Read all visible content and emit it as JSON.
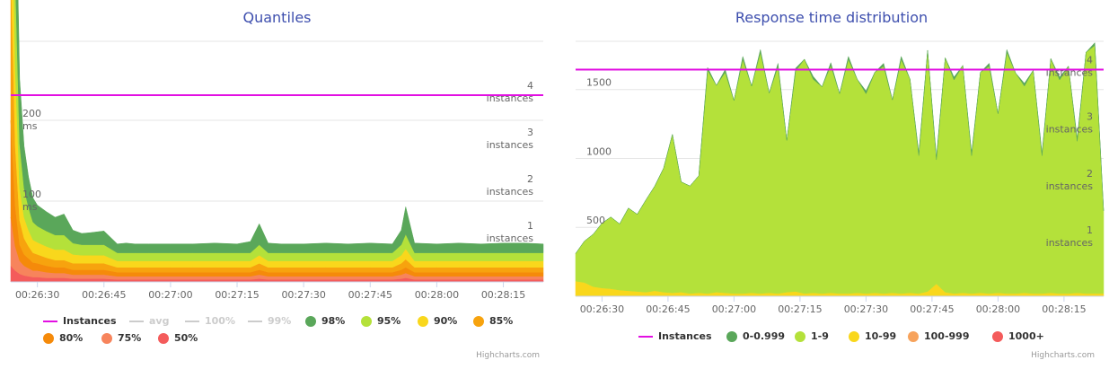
{
  "chart_data": [
    {
      "type": "area",
      "title": "Quantiles",
      "x": [
        "00:26:24",
        "00:26:25",
        "00:26:26",
        "00:26:27",
        "00:26:28",
        "00:26:29",
        "00:26:30",
        "00:26:32",
        "00:26:34",
        "00:26:36",
        "00:26:38",
        "00:26:40",
        "00:26:42",
        "00:26:45",
        "00:26:48",
        "00:26:50",
        "00:26:52",
        "00:26:55",
        "00:27:00",
        "00:27:05",
        "00:27:10",
        "00:27:15",
        "00:27:18",
        "00:27:20",
        "00:27:22",
        "00:27:25",
        "00:27:30",
        "00:27:35",
        "00:27:40",
        "00:27:45",
        "00:27:50",
        "00:27:52",
        "00:27:53",
        "00:27:55",
        "00:28:00",
        "00:28:05",
        "00:28:10",
        "00:28:15",
        "00:28:20",
        "00:28:24"
      ],
      "x_ticks": [
        "00:26:30",
        "00:26:45",
        "00:27:00",
        "00:27:15",
        "00:27:30",
        "00:27:45",
        "00:28:00",
        "00:28:15"
      ],
      "y_ticks": [
        {
          "value": 100,
          "label_num": "100",
          "label_unit": "ms"
        },
        {
          "value": 200,
          "label_num": "200",
          "label_unit": "ms"
        }
      ],
      "ylim": [
        0,
        260
      ],
      "y2_ticks": [
        {
          "value": 1,
          "label_num": "1",
          "label_unit": "instances"
        },
        {
          "value": 2,
          "label_num": "2",
          "label_unit": "instances"
        },
        {
          "value": 3,
          "label_num": "3",
          "label_unit": "instances"
        },
        {
          "value": 4,
          "label_num": "4",
          "label_unit": "instances"
        }
      ],
      "y2lim": [
        0,
        4.5
      ],
      "instances_value": 4,
      "series": [
        {
          "name": "50%",
          "color": "#f45b5b",
          "values": [
            20,
            14,
            10,
            8,
            7,
            6,
            6,
            5,
            5,
            5,
            4,
            4,
            4,
            4,
            3,
            3,
            3,
            3,
            3,
            3,
            3,
            3,
            3,
            4,
            3,
            3,
            3,
            3,
            3,
            3,
            3,
            4,
            5,
            3,
            3,
            3,
            3,
            3,
            3,
            3
          ]
        },
        {
          "name": "75%",
          "color": "#f7845c",
          "values": [
            60,
            30,
            16,
            12,
            10,
            8,
            8,
            7,
            6,
            6,
            5,
            5,
            5,
            5,
            4,
            4,
            4,
            4,
            4,
            4,
            4,
            4,
            4,
            5,
            4,
            4,
            4,
            4,
            4,
            4,
            4,
            5,
            6,
            4,
            4,
            4,
            4,
            4,
            4,
            4
          ]
        },
        {
          "name": "80%",
          "color": "#f58a0a",
          "values": [
            120,
            50,
            20,
            14,
            12,
            10,
            9,
            8,
            7,
            7,
            6,
            6,
            6,
            6,
            5,
            5,
            5,
            5,
            5,
            5,
            5,
            5,
            5,
            6,
            5,
            5,
            5,
            5,
            5,
            5,
            5,
            6,
            7,
            5,
            5,
            5,
            5,
            5,
            5,
            5
          ]
        },
        {
          "name": "85%",
          "color": "#f7a30e",
          "values": [
            190,
            75,
            30,
            20,
            15,
            12,
            11,
            10,
            9,
            9,
            8,
            8,
            8,
            8,
            6,
            6,
            6,
            6,
            6,
            6,
            6,
            6,
            6,
            8,
            6,
            6,
            6,
            6,
            6,
            6,
            6,
            8,
            10,
            6,
            6,
            6,
            6,
            6,
            6,
            6
          ]
        },
        {
          "name": "90%",
          "color": "#f9d71c",
          "values": [
            220,
            95,
            40,
            26,
            20,
            16,
            15,
            14,
            13,
            13,
            11,
            10,
            10,
            10,
            8,
            8,
            8,
            8,
            8,
            8,
            8,
            8,
            8,
            10,
            8,
            8,
            8,
            8,
            8,
            8,
            8,
            10,
            13,
            8,
            8,
            8,
            8,
            8,
            8,
            8
          ]
        },
        {
          "name": "95%",
          "color": "#b4e13a",
          "values": [
            240,
            120,
            55,
            36,
            28,
            22,
            20,
            19,
            18,
            18,
            14,
            13,
            13,
            13,
            10,
            10,
            10,
            10,
            10,
            10,
            10,
            10,
            10,
            13,
            10,
            10,
            10,
            10,
            10,
            10,
            10,
            13,
            18,
            10,
            10,
            10,
            10,
            10,
            10,
            10
          ]
        },
        {
          "name": "98%",
          "color": "#5aa75a",
          "values": [
            258,
            160,
            80,
            52,
            38,
            30,
            26,
            24,
            22,
            26,
            16,
            14,
            15,
            17,
            11,
            12,
            11,
            11,
            11,
            11,
            12,
            11,
            14,
            26,
            12,
            11,
            11,
            12,
            11,
            12,
            11,
            18,
            34,
            12,
            11,
            12,
            11,
            12,
            12,
            11
          ]
        }
      ],
      "legend": [
        {
          "name": "Instances",
          "kind": "line",
          "color": "#e20fe2",
          "visible": true
        },
        {
          "name": "avg",
          "kind": "line",
          "color": "#cccccc",
          "visible": false
        },
        {
          "name": "100%",
          "kind": "line",
          "color": "#cccccc",
          "visible": false
        },
        {
          "name": "99%",
          "kind": "line",
          "color": "#cccccc",
          "visible": false
        },
        {
          "name": "98%",
          "kind": "dot",
          "color": "#5aa75a",
          "visible": true
        },
        {
          "name": "95%",
          "kind": "dot",
          "color": "#b4e13a",
          "visible": true
        },
        {
          "name": "90%",
          "kind": "dot",
          "color": "#f9d71c",
          "visible": true
        },
        {
          "name": "85%",
          "kind": "dot",
          "color": "#f7a30e",
          "visible": true
        },
        {
          "name": "80%",
          "kind": "dot",
          "color": "#f58a0a",
          "visible": true
        },
        {
          "name": "75%",
          "kind": "dot",
          "color": "#f7845c",
          "visible": true
        },
        {
          "name": "50%",
          "kind": "dot",
          "color": "#f45b5b",
          "visible": true
        }
      ],
      "credits": "Highcharts.com"
    },
    {
      "type": "area",
      "title": "Response time distribution",
      "x": [
        "00:26:24",
        "00:26:26",
        "00:26:28",
        "00:26:30",
        "00:26:32",
        "00:26:34",
        "00:26:36",
        "00:26:38",
        "00:26:40",
        "00:26:42",
        "00:26:44",
        "00:26:46",
        "00:26:48",
        "00:26:50",
        "00:26:52",
        "00:26:54",
        "00:26:56",
        "00:26:58",
        "00:27:00",
        "00:27:02",
        "00:27:04",
        "00:27:06",
        "00:27:08",
        "00:27:10",
        "00:27:12",
        "00:27:14",
        "00:27:16",
        "00:27:18",
        "00:27:20",
        "00:27:22",
        "00:27:24",
        "00:27:26",
        "00:27:28",
        "00:27:30",
        "00:27:32",
        "00:27:34",
        "00:27:36",
        "00:27:38",
        "00:27:40",
        "00:27:42",
        "00:27:44",
        "00:27:46",
        "00:27:48",
        "00:27:50",
        "00:27:52",
        "00:27:54",
        "00:27:56",
        "00:27:58",
        "00:28:00",
        "00:28:02",
        "00:28:04",
        "00:28:06",
        "00:28:08",
        "00:28:10",
        "00:28:12",
        "00:28:14",
        "00:28:16",
        "00:28:18",
        "00:28:20",
        "00:28:22",
        "00:28:24"
      ],
      "x_ticks": [
        "00:26:30",
        "00:26:45",
        "00:27:00",
        "00:27:15",
        "00:27:30",
        "00:27:45",
        "00:28:00",
        "00:28:15"
      ],
      "y_ticks": [
        {
          "value": 500,
          "label_num": "500"
        },
        {
          "value": 1000,
          "label_num": "1000"
        },
        {
          "value": 1500,
          "label_num": "1500"
        }
      ],
      "ylim": [
        0,
        1850
      ],
      "y2_ticks": [
        {
          "value": 1,
          "label_num": "1",
          "label_unit": "instances"
        },
        {
          "value": 2,
          "label_num": "2",
          "label_unit": "instances"
        },
        {
          "value": 3,
          "label_num": "3",
          "label_unit": "instances"
        },
        {
          "value": 4,
          "label_num": "4",
          "label_unit": "instances"
        }
      ],
      "y2lim": [
        0,
        4.5
      ],
      "instances_value": 4,
      "series": [
        {
          "name": "10-99",
          "color": "#f9d71c",
          "values": [
            110,
            100,
            70,
            60,
            55,
            45,
            40,
            35,
            30,
            40,
            30,
            25,
            30,
            20,
            25,
            20,
            30,
            25,
            20,
            20,
            25,
            20,
            25,
            20,
            30,
            35,
            20,
            25,
            20,
            25,
            20,
            20,
            25,
            20,
            25,
            20,
            25,
            20,
            25,
            20,
            35,
            90,
            30,
            20,
            25,
            20,
            25,
            20,
            25,
            20,
            20,
            25,
            20,
            20,
            25,
            20,
            20,
            25,
            20,
            20,
            20
          ]
        },
        {
          "name": "1-9",
          "color": "#b4e13a",
          "values": [
            200,
            300,
            380,
            470,
            520,
            480,
            600,
            560,
            670,
            760,
            900,
            1150,
            800,
            780,
            850,
            1620,
            1500,
            1600,
            1400,
            1700,
            1500,
            1750,
            1450,
            1650,
            1100,
            1600,
            1700,
            1550,
            1500,
            1650,
            1450,
            1700,
            1550,
            1450,
            1600,
            1650,
            1400,
            1700,
            1550,
            1000,
            1750,
            900,
            1700,
            1550,
            1650,
            1000,
            1600,
            1650,
            1300,
            1750,
            1600,
            1500,
            1620,
            1000,
            1700,
            1550,
            1650,
            1100,
            1750,
            1800,
            600
          ]
        },
        {
          "name": "0-0.999",
          "color": "#5aa75a",
          "values": [
            0,
            0,
            0,
            0,
            0,
            0,
            0,
            0,
            0,
            0,
            0,
            0,
            0,
            0,
            0,
            20,
            0,
            20,
            0,
            20,
            0,
            20,
            0,
            20,
            0,
            20,
            0,
            20,
            0,
            20,
            0,
            20,
            0,
            20,
            0,
            20,
            0,
            20,
            0,
            20,
            0,
            20,
            0,
            20,
            0,
            20,
            0,
            20,
            0,
            20,
            0,
            20,
            0,
            20,
            0,
            20,
            0,
            20,
            0,
            20,
            0
          ]
        }
      ],
      "legend": [
        {
          "name": "Instances",
          "kind": "line",
          "color": "#e20fe2",
          "visible": true
        },
        {
          "name": "0-0.999",
          "kind": "dot",
          "color": "#5aa75a",
          "visible": true
        },
        {
          "name": "1-9",
          "kind": "dot",
          "color": "#b4e13a",
          "visible": true
        },
        {
          "name": "10-99",
          "kind": "dot",
          "color": "#f9d71c",
          "visible": true
        },
        {
          "name": "100-999",
          "kind": "dot",
          "color": "#f7a35c",
          "visible": true
        },
        {
          "name": "1000+",
          "kind": "dot",
          "color": "#f45b5b",
          "visible": true
        }
      ],
      "credits": "Highcharts.com"
    }
  ]
}
